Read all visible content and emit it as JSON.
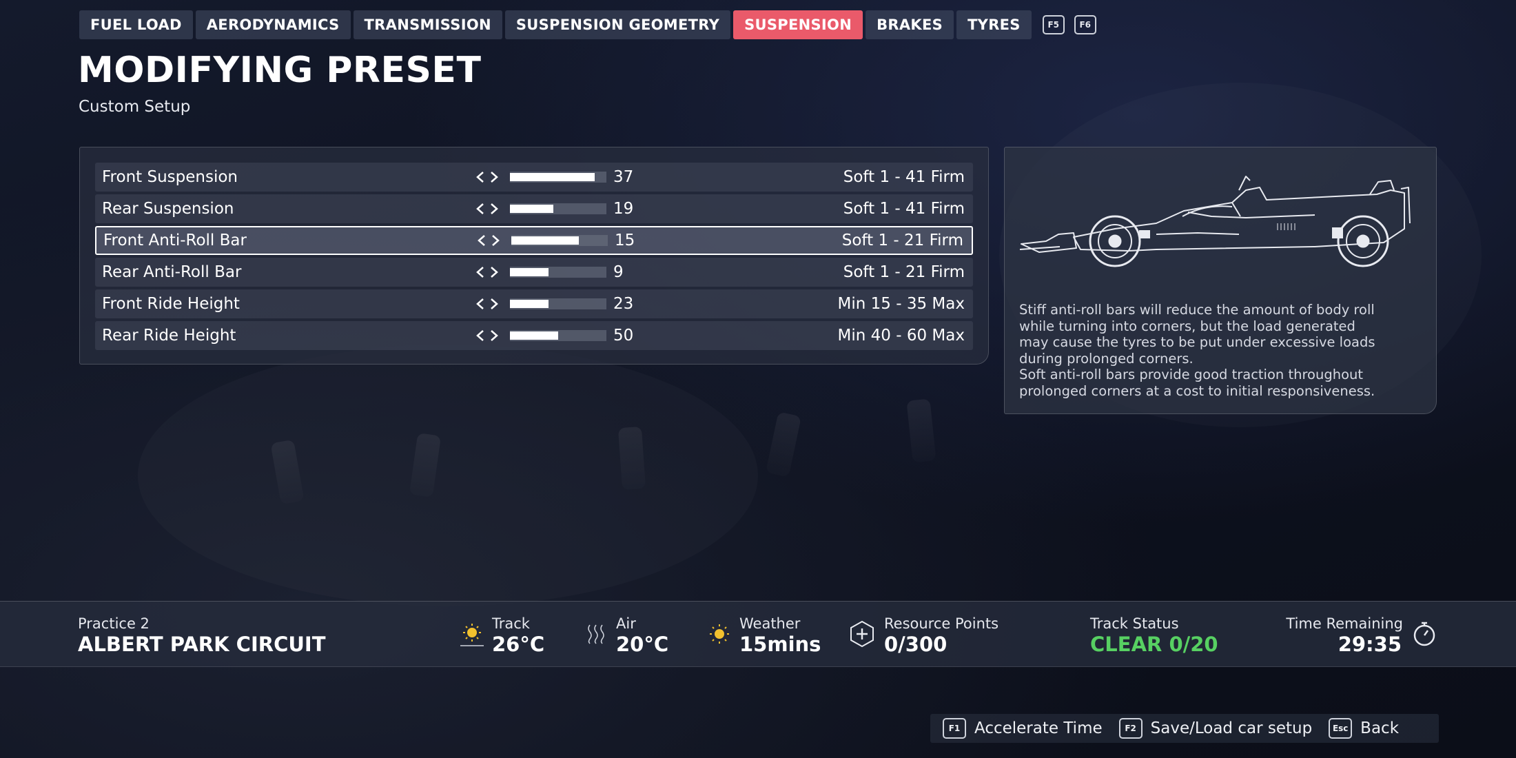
{
  "tabs": [
    {
      "label": "FUEL LOAD",
      "active": false
    },
    {
      "label": "AERODYNAMICS",
      "active": false
    },
    {
      "label": "TRANSMISSION",
      "active": false
    },
    {
      "label": "SUSPENSION GEOMETRY",
      "active": false
    },
    {
      "label": "SUSPENSION",
      "active": true
    },
    {
      "label": "BRAKES",
      "active": false
    },
    {
      "label": "TYRES",
      "active": false
    }
  ],
  "tab_hotkeys": [
    "F5",
    "F6"
  ],
  "header": {
    "title": "MODIFYING PRESET",
    "subtitle": "Custom Setup"
  },
  "settings": [
    {
      "name": "Front Suspension",
      "value": "37",
      "range": "Soft 1 - 41 Firm",
      "fill": 0.88,
      "selected": false
    },
    {
      "name": "Rear Suspension",
      "value": "19",
      "range": "Soft 1 - 41 Firm",
      "fill": 0.45,
      "selected": false
    },
    {
      "name": "Front Anti-Roll Bar",
      "value": "15",
      "range": "Soft 1 - 21 Firm",
      "fill": 0.7,
      "selected": true
    },
    {
      "name": "Rear Anti-Roll Bar",
      "value": "9",
      "range": "Soft 1 - 21 Firm",
      "fill": 0.4,
      "selected": false
    },
    {
      "name": "Front Ride Height",
      "value": "23",
      "range": "Min 15 - 35 Max",
      "fill": 0.4,
      "selected": false
    },
    {
      "name": "Rear Ride Height",
      "value": "50",
      "range": "Min 40 - 60 Max",
      "fill": 0.5,
      "selected": false
    }
  ],
  "info": {
    "lines": [
      "Stiff anti-roll bars will reduce the amount of body roll",
      "while turning into corners, but the load generated",
      "may cause the tyres to be put under excessive loads",
      "during prolonged corners.",
      "Soft anti-roll bars provide good traction throughout",
      "prolonged corners at a cost to initial responsiveness."
    ]
  },
  "status": {
    "session": "Practice 2",
    "circuit": "ALBERT PARK CIRCUIT",
    "track_label": "Track",
    "track_value": "26°C",
    "air_label": "Air",
    "air_value": "20°C",
    "weather_label": "Weather",
    "weather_value": "15mins",
    "resource_label": "Resource Points",
    "resource_value": "0/300",
    "track_status_label": "Track Status",
    "track_status_value": "CLEAR 0/20",
    "time_label": "Time Remaining",
    "time_value": "29:35"
  },
  "footer": {
    "hints": [
      {
        "key": "F1",
        "label": "Accelerate Time"
      },
      {
        "key": "F2",
        "label": "Save/Load car setup"
      },
      {
        "key": "Esc",
        "label": "Back"
      }
    ]
  },
  "colors": {
    "accent": "#ea5a6a",
    "status_green": "#57d062",
    "sun_yellow": "#f2c12e"
  }
}
